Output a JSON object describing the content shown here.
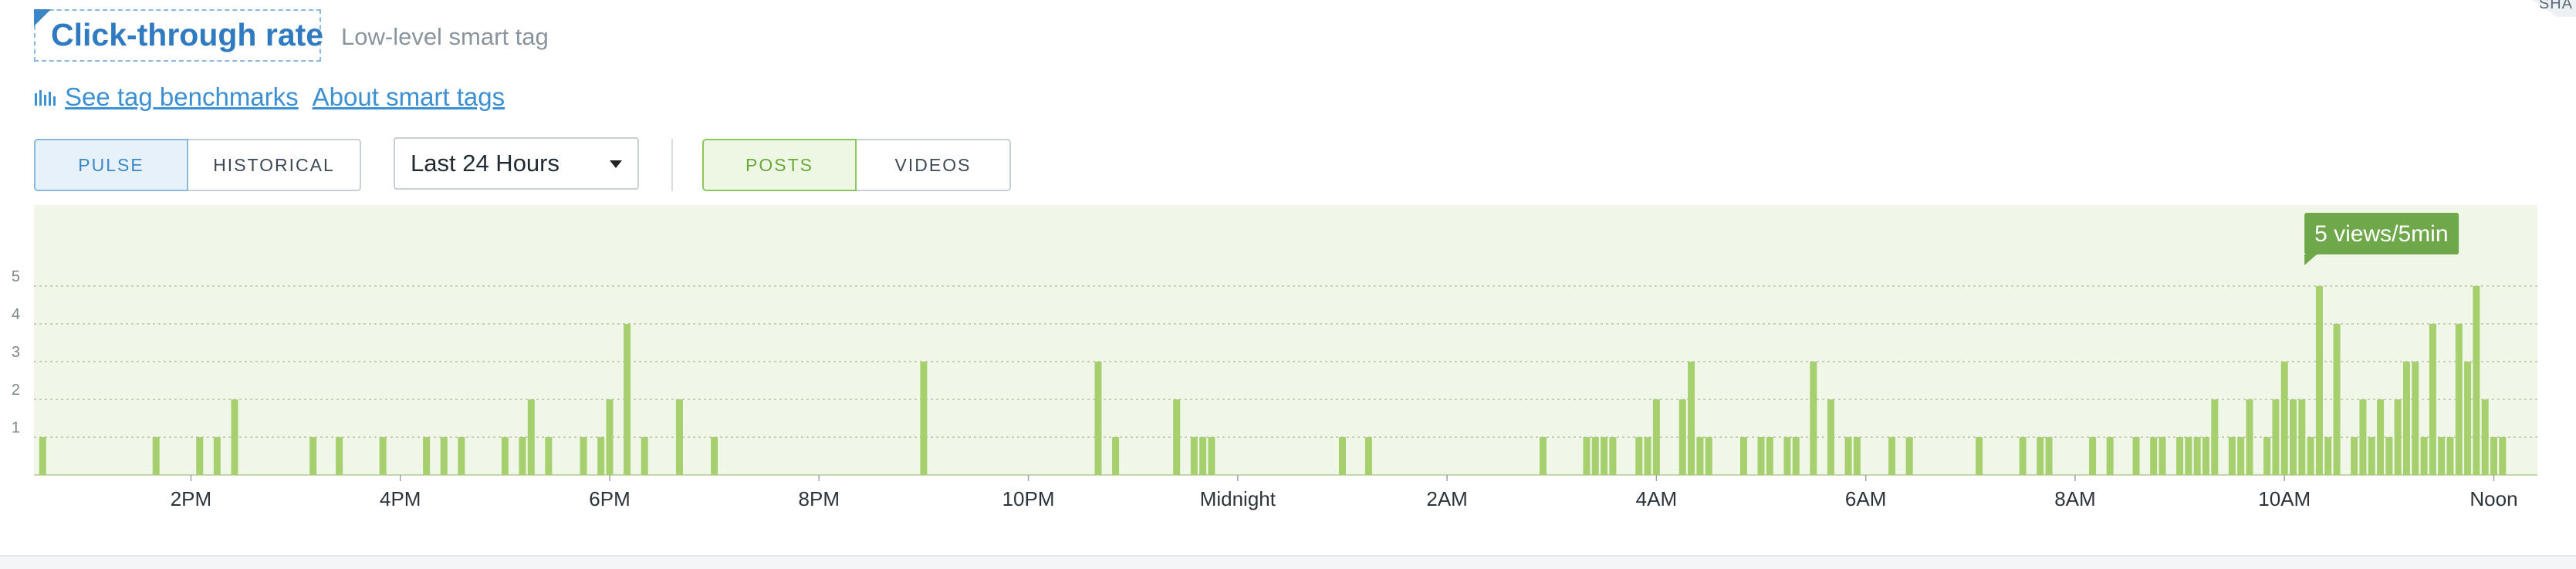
{
  "header": {
    "title": "Click-through rate",
    "subtitle": "Low-level smart tag",
    "corner_label": "SHA"
  },
  "links": {
    "benchmarks_icon": "bar-chart-icon",
    "benchmarks": "See tag benchmarks",
    "about": "About smart tags"
  },
  "mode_toggle": {
    "pulse": "PULSE",
    "historical": "HISTORICAL",
    "active": "PULSE"
  },
  "timeframe": {
    "selected": "Last 24 Hours"
  },
  "content_toggle": {
    "posts": "POSTS",
    "videos": "VIDEOS",
    "active": "POSTS"
  },
  "colors": {
    "accent_blue": "#2f7ac0",
    "bar_green": "#a6cf6d",
    "tooltip_green": "#6fa84a",
    "plot_bg": "#f1f7e8"
  },
  "chart_data": {
    "type": "bar",
    "title": "",
    "xlabel": "",
    "ylabel": "",
    "ylim": [
      0,
      5
    ],
    "y_ticks": [
      "1",
      "2",
      "3",
      "4",
      "5"
    ],
    "x_tick_labels": [
      "2PM",
      "4PM",
      "6PM",
      "8PM",
      "10PM",
      "Midnight",
      "2AM",
      "4AM",
      "6AM",
      "8AM",
      "10AM",
      "Noon"
    ],
    "x_range_minutes": [
      -90,
      1345
    ],
    "x_tick_minutes": [
      0,
      120,
      240,
      360,
      480,
      600,
      720,
      840,
      960,
      1080,
      1200,
      1320
    ],
    "tooltip": "5 views/5min",
    "tooltip_minute": 1215,
    "series": [
      {
        "x": [
          -85,
          -20,
          5,
          15,
          25,
          70,
          85,
          110,
          135,
          145,
          155,
          180,
          190,
          195,
          205,
          225,
          235,
          240,
          250,
          260,
          280,
          300,
          420,
          520,
          530,
          565,
          575,
          580,
          585,
          660,
          675,
          775,
          800,
          805,
          810,
          815,
          830,
          835,
          840,
          855,
          860,
          865,
          870,
          890,
          900,
          905,
          915,
          920,
          930,
          940,
          950,
          955,
          975,
          985,
          1025,
          1050,
          1060,
          1065,
          1090,
          1100,
          1115,
          1125,
          1130,
          1140,
          1145,
          1150,
          1155,
          1160,
          1170,
          1175,
          1180,
          1190,
          1195,
          1200,
          1205,
          1210,
          1215,
          1220,
          1225,
          1230,
          1240,
          1245,
          1250,
          1255,
          1260,
          1265,
          1270,
          1275,
          1280,
          1285,
          1290,
          1295,
          1300,
          1305,
          1310,
          1315,
          1320,
          1325
        ],
        "values": [
          1,
          1,
          1,
          1,
          2,
          1,
          1,
          1,
          1,
          1,
          1,
          1,
          1,
          2,
          1,
          1,
          1,
          2,
          4,
          1,
          2,
          1,
          3,
          3,
          1,
          2,
          1,
          1,
          1,
          1,
          1,
          1,
          1,
          1,
          1,
          1,
          1,
          1,
          2,
          2,
          3,
          1,
          1,
          1,
          1,
          1,
          1,
          1,
          3,
          2,
          1,
          1,
          1,
          1,
          1,
          1,
          1,
          1,
          1,
          1,
          1,
          1,
          1,
          1,
          1,
          1,
          1,
          2,
          1,
          1,
          2,
          1,
          2,
          3,
          2,
          2,
          1,
          5,
          1,
          4,
          1,
          2,
          1,
          2,
          1,
          2,
          3,
          3,
          1,
          4,
          1,
          1,
          4,
          3,
          5,
          2,
          1,
          1
        ]
      }
    ]
  }
}
